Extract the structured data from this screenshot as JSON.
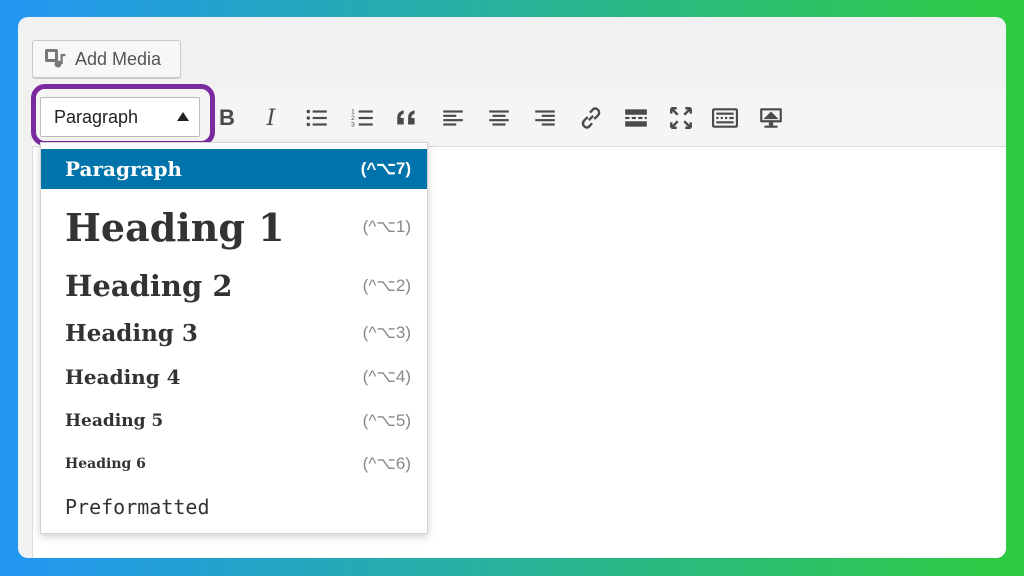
{
  "colors": {
    "accent": "#0073aa",
    "highlight_ring": "#7b2aa0",
    "background_left": "#2196f3",
    "background_right": "#2ecc40"
  },
  "media": {
    "add_media_label": "Add Media",
    "icon": "media-icon"
  },
  "format_select": {
    "value": "Paragraph"
  },
  "toolbar": {
    "icons": [
      "bold-icon",
      "italic-icon",
      "bulleted-list-icon",
      "numbered-list-icon",
      "blockquote-icon",
      "align-left-icon",
      "align-center-icon",
      "align-right-icon",
      "link-icon",
      "read-more-icon",
      "fullscreen-icon",
      "toolbar-toggle-icon",
      "preview-icon"
    ],
    "bold_label": "B",
    "italic_label": "I"
  },
  "dropdown": {
    "items": [
      {
        "label": "Paragraph",
        "shortcut": "(^⌥7)",
        "selected": true
      },
      {
        "label": "Heading 1",
        "shortcut": "(^⌥1)"
      },
      {
        "label": "Heading 2",
        "shortcut": "(^⌥2)"
      },
      {
        "label": "Heading 3",
        "shortcut": "(^⌥3)"
      },
      {
        "label": "Heading 4",
        "shortcut": "(^⌥4)"
      },
      {
        "label": "Heading 5",
        "shortcut": "(^⌥5)"
      },
      {
        "label": "Heading 6",
        "shortcut": "(^⌥6)"
      },
      {
        "label": "Preformatted",
        "shortcut": ""
      }
    ]
  }
}
